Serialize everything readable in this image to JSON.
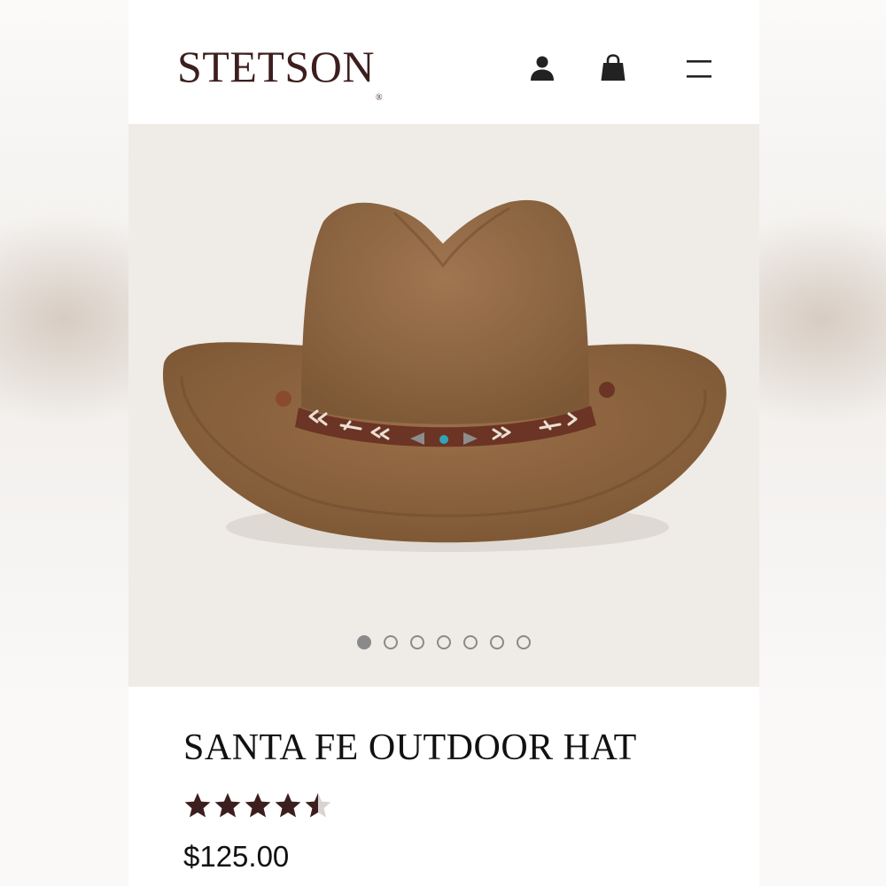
{
  "header": {
    "logo_text": "STETSON",
    "logo_mark": "®",
    "icons": [
      "user-icon",
      "shopping-bag-icon",
      "menu-icon"
    ]
  },
  "gallery": {
    "slide_count": 7,
    "active_slide": 1
  },
  "product": {
    "name": "SANTA FE OUTDOOR HAT",
    "rating": 4.5,
    "rating_max": 5,
    "price": "$125.00"
  },
  "colors": {
    "brand": "#3d1e1e",
    "hat_felt": "#8b6440",
    "hat_band": "#6b3424",
    "star": "#3d1e1e"
  }
}
